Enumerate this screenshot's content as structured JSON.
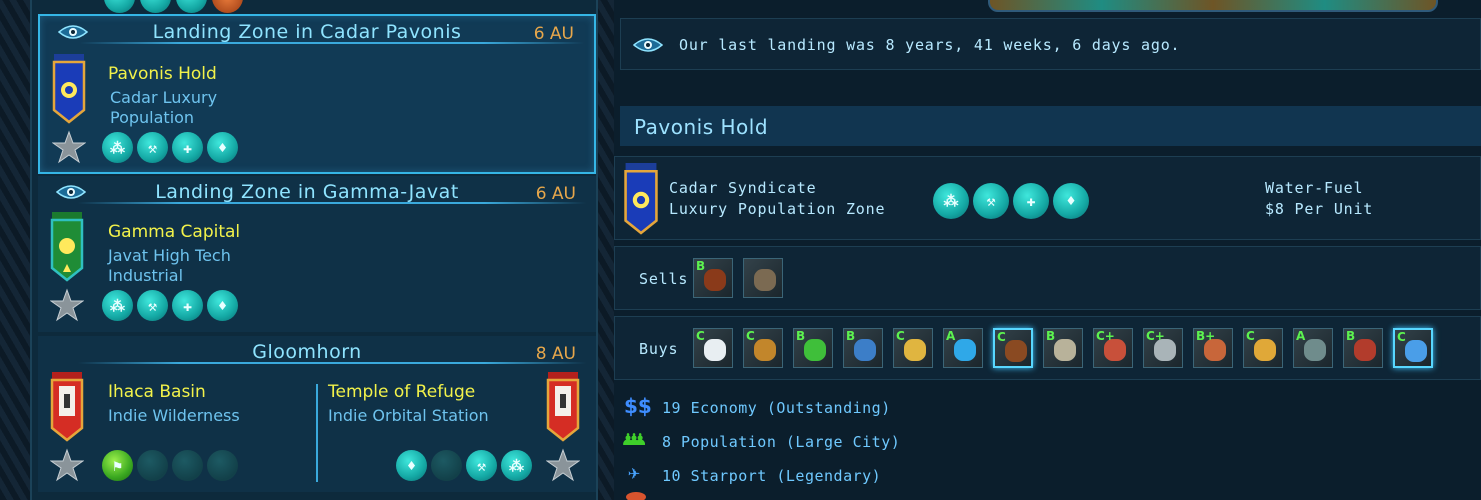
{
  "zones": [
    {
      "title": "Landing Zone in Cadar Pavonis",
      "distance": "6 AU",
      "planet_name": "Pavonis Hold",
      "desc_line1": "Cadar Luxury",
      "desc_line2": "Population",
      "icons": [
        "three-dots-icon",
        "wrench-icon",
        "bandage-icon",
        "crystal-icon"
      ]
    },
    {
      "title": "Landing Zone in Gamma-Javat",
      "distance": "6 AU",
      "planet_name": "Gamma Capital",
      "desc_line1": "Javat High Tech",
      "desc_line2": "Industrial",
      "icons": [
        "three-dots-icon",
        "wrench-icon",
        "bandage-icon",
        "crystal-icon"
      ]
    },
    {
      "title": "Gloomhorn",
      "distance": "8 AU",
      "left_name": "Ihaca Basin",
      "left_desc": "Indie Wilderness",
      "right_name": "Temple of Refuge",
      "right_desc": "Indie Orbital Station"
    }
  ],
  "detail": {
    "last_landing": "Our last landing was 8 years, 41 weeks, 6 days ago.",
    "title": "Pavonis Hold",
    "faction_line1": "Cadar Syndicate",
    "faction_line2": "Luxury Population Zone",
    "fuel_line1": "Water-Fuel",
    "fuel_line2": "$8 Per Unit",
    "sells_label": "Sells",
    "buys_label": "Buys",
    "sells": [
      {
        "grade": "B",
        "name": "food-icon"
      },
      {
        "grade": "",
        "name": "scrap-icon"
      }
    ],
    "buys": [
      {
        "grade": "C",
        "name": "medkit-icon"
      },
      {
        "grade": "C",
        "name": "pilot-icon"
      },
      {
        "grade": "B",
        "name": "plant-icon"
      },
      {
        "grade": "B",
        "name": "tech-icon"
      },
      {
        "grade": "C",
        "name": "wheat-icon"
      },
      {
        "grade": "A",
        "name": "atom-icon"
      },
      {
        "grade": "C",
        "name": "leather-icon"
      },
      {
        "grade": "B",
        "name": "mineral-icon"
      },
      {
        "grade": "C+",
        "name": "meat-icon"
      },
      {
        "grade": "C+",
        "name": "machine-icon"
      },
      {
        "grade": "B+",
        "name": "produce-icon"
      },
      {
        "grade": "C",
        "name": "chemical-icon"
      },
      {
        "grade": "A",
        "name": "robot-icon"
      },
      {
        "grade": "B",
        "name": "drink-icon"
      },
      {
        "grade": "C",
        "name": "orb-icon"
      }
    ],
    "stats": [
      {
        "icon": "dollar-icon",
        "text": "19 Economy (Outstanding)"
      },
      {
        "icon": "people-icon",
        "text": "8 Population (Large City)"
      },
      {
        "icon": "ship-icon",
        "text": "10 Starport (Legendary)"
      }
    ]
  },
  "colors": {
    "accent": "#35b6e6",
    "planet_name": "#f2f24a",
    "distance": "#e7a74b",
    "grade": "#5cf24f"
  }
}
